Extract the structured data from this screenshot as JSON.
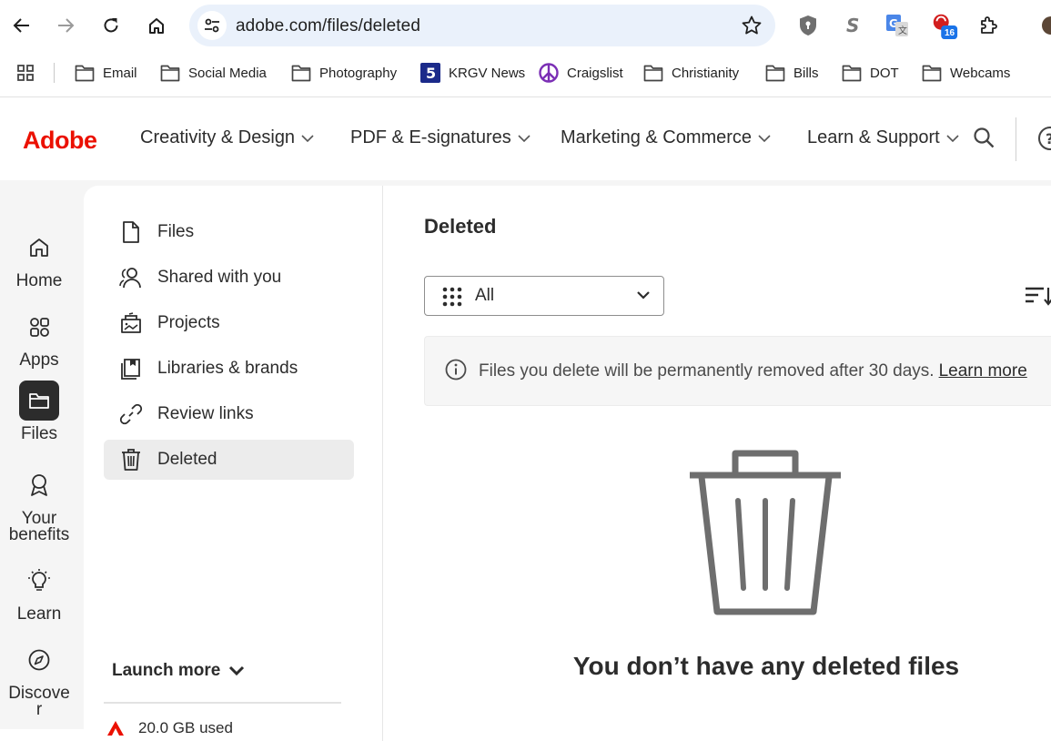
{
  "browser": {
    "url": "adobe.com/files/deleted",
    "extension_badge": "16",
    "bookmarks": [
      "Email",
      "Social Media",
      "Photography",
      "KRGV News",
      "Craigslist",
      "Christianity",
      "Bills",
      "DOT",
      "Webcams"
    ]
  },
  "header": {
    "logo": "Adobe",
    "nav": [
      "Creativity & Design",
      "PDF & E-signatures",
      "Marketing & Commerce",
      "Learn & Support"
    ]
  },
  "rail": {
    "items": [
      "Home",
      "Apps",
      "Files",
      "Your benefits",
      "Learn",
      "Discover"
    ]
  },
  "sidebar": {
    "items": [
      "Files",
      "Shared with you",
      "Projects",
      "Libraries & brands",
      "Review links",
      "Deleted"
    ],
    "launch_more": "Launch more",
    "storage": "20.0 GB used"
  },
  "main": {
    "title": "Deleted",
    "filter_value": "All",
    "notice": "Files you delete will be permanently removed after 30 days.",
    "notice_link": "Learn more",
    "empty_message": "You don’t have any deleted files"
  },
  "colors": {
    "brand": "#eb1000",
    "omnibox": "#eaf1fb",
    "active_rail": "#2c2c2c"
  }
}
